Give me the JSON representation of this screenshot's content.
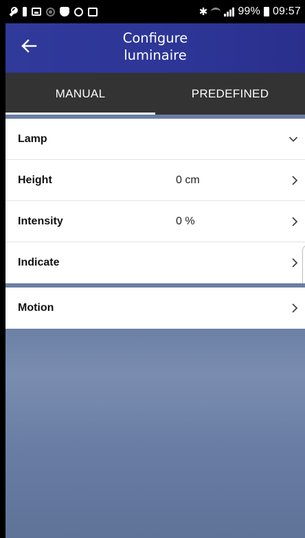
{
  "status_bar": {
    "battery": "99%",
    "time": "09:57"
  },
  "header": {
    "title_line1": "Configure",
    "title_line2": "luminaire"
  },
  "tabs": [
    {
      "label": "MANUAL",
      "active": true
    },
    {
      "label": "PREDEFINED",
      "active": false
    }
  ],
  "lamp_section": {
    "rows": [
      {
        "label": "Lamp",
        "value": "",
        "chevron": "chevron-down-icon"
      },
      {
        "label": "Height",
        "value": "0 cm",
        "chevron": "chevron-right-icon"
      },
      {
        "label": "Intensity",
        "value": "0 %",
        "chevron": "chevron-right-icon"
      },
      {
        "label": "Indicate",
        "value": "",
        "chevron": "chevron-right-icon"
      }
    ]
  },
  "motion_section": {
    "label": "Motion",
    "chevron": "chevron-right-icon"
  },
  "colors": {
    "app_bar": "#2d3596",
    "tab_bar": "#333333",
    "background": "#62779c"
  }
}
